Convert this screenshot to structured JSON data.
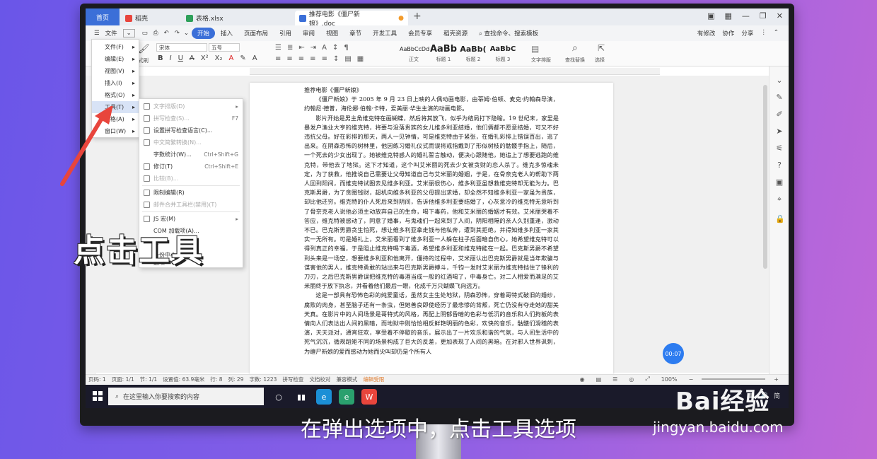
{
  "tabs": {
    "home": "首页",
    "t1": "稻壳",
    "t2": "表格.xlsx",
    "t3": "推荐电影《僵尸新娘》.doc"
  },
  "menubar": {
    "items": [
      "文件",
      "开始",
      "插入",
      "页面布局",
      "引用",
      "审阅",
      "视图",
      "章节",
      "开发工具",
      "会员专享",
      "稻壳资源"
    ],
    "active": "开始",
    "search": "查找命令、搜索模板",
    "right": [
      "有修改",
      "协作",
      "分享"
    ]
  },
  "ribbon": {
    "font_name": "宋体",
    "font_size": "五号",
    "styles": [
      {
        "preview": "AaBbCcDd",
        "label": "正文"
      },
      {
        "preview": "AaBb",
        "label": "标题 1"
      },
      {
        "preview": "AaBb(",
        "label": "标题 2"
      },
      {
        "preview": "AaBbC",
        "label": "标题 3"
      }
    ],
    "text_tool": "文字排版",
    "find_replace": "查找替换",
    "select": "选择",
    "fmt": "式刷"
  },
  "menu1": {
    "items": [
      {
        "label": "文件(F)",
        "arrow": "▸"
      },
      {
        "label": "编辑(E)",
        "arrow": "▸"
      },
      {
        "label": "视图(V)",
        "arrow": "▸"
      },
      {
        "label": "插入(I)",
        "arrow": "▸"
      },
      {
        "label": "格式(O)",
        "arrow": "▸"
      },
      {
        "label": "工具(T)",
        "arrow": "▸"
      },
      {
        "label": "表格(A)",
        "arrow": "▸"
      },
      {
        "label": "窗口(W)",
        "arrow": "▸"
      }
    ]
  },
  "menu2": {
    "items": [
      {
        "label": "文字排版(D)",
        "shortcut": "▸",
        "disabled": true
      },
      {
        "label": "拼写检查(S)...",
        "shortcut": "F7",
        "disabled": true
      },
      {
        "label": "设置拼写检查语言(C)...",
        "shortcut": "",
        "disabled": false
      },
      {
        "label": "中文简繁转换(N)...",
        "shortcut": "",
        "disabled": true
      },
      {
        "label": "字数统计(W)...",
        "shortcut": "Ctrl+Shift+G",
        "disabled": false
      },
      {
        "label": "修订(T)",
        "shortcut": "Ctrl+Shift+E",
        "disabled": false
      },
      {
        "label": "比较(B)...",
        "shortcut": "",
        "disabled": true
      },
      {
        "label": "限制编辑(R)",
        "shortcut": "",
        "disabled": false
      },
      {
        "label": "邮件合并工具栏(禁用)(T)",
        "shortcut": "",
        "disabled": true
      },
      {
        "label": "JS 宏(M)",
        "shortcut": "▸",
        "disabled": false
      },
      {
        "label": "COM 加载项(A)...",
        "shortcut": "",
        "disabled": false
      },
      {
        "label": "...",
        "shortcut": "",
        "disabled": false
      },
      {
        "label": "备份中心",
        "shortcut": "",
        "disabled": false
      },
      {
        "label": "选项",
        "shortcut": "",
        "disabled": false
      }
    ]
  },
  "document": {
    "title": "推荐电影《僵尸新娘》",
    "paragraphs": [
      "《僵尸新娘》于 2005 年 9 月 23 日上映的人偶动画电影，由蒂姆·伯顿、麦克·约翰森导演，约翰尼·德普，海伦娜·伯翰·卡特，爱美丽·华生主演的动画电影。",
      "影片开始是男主角维克特在画蝴蝶，然后将其放飞，似乎为结局打下隐喻。19 世纪末，家里是暴发户渔业大亨的维克特，将要与没落贵族的女儿维多利亚结婚，他们俩都不愿意结婚，可又不好违抗父母。好在彩排的那天，两人一见钟情，可是维克特由于紧张，在婚礼彩排上错误百出，逃了出来。在阴森恐怖的树林里，他因练习婚礼仪式而误将戒指戴到了形似树枝的骷髅手指上，随后，一个死去的少女出现了。她被维克特感人的婚礼誓言触动，便决心跟随他，她追上了想要逃跑的维克特，带他去了地狱。这下才知道，这个叫艾米丽的死去少女被贪财的恋人杀了。维克多惊魂未定，为了获救，他推说自己需要让父母知道自己与艾米丽的婚姻，于是，在骨奈克老人的帮助下两人回到阳间，而维克特试图去见维多利亚。艾米丽很伤心，维多利亚虽想救维克特却无能为力。巴克斯男爵，为了贪图钱财，超机向维多利亚的父母提出求婚，却全然不知维多利亚一家虽为贵族，却比他还穷。维克特的仆人死后来到阴间，告诉他维多利亚要结婚了，心灰意冷的维克特无意听到了骨奈克老人说他必须主动放弃自己的生命，喝下毒药，他和艾米丽的婚姻才有效。艾米丽哭着不答应，维克特被感动了，同意了婚事，与鬼魂们一起来到了人间，阴阳相隔的亲人久别重逢，激动不已。巴克斯男爵贪生怕死，想让维多利亚拿走钱与他私奔，遭到其拒绝，并得知维多利亚一家其实一无所有。可是婚礼上，艾米丽看到了维多利亚一人躲在柱子后面暗自伤心，她希望维克特可以得到真正的幸福，于是阻止维克特喝下毒酒，希望维多利亚和维克特能在一起。巴克斯男爵不希望到头来是一场空，想要维多利亚和他离开，僵持的过程中，艾米丽认出巴克斯男爵就是当年欺骗与谋害他的男人，维克特勇敢的站出来与巴克斯男爵搏斗，千钧一发时艾米丽为维克特挡住了锋利的刀刃，之后巴克斯男爵误把维克特的毒酒当成一般的红酒喝了，中毒身亡。对二人相爱而满足的艾米丽终于放下执念，并看着他们最后一眼，化成千万只蝴蝶飞向远方。",
      "这是一部具有恐怖色彩的纯爱童话，虽然女主生处地狱，阴森恐怖，穿着哥特式破旧的婚纱，腐败的肉身，甚至脑子还有一条虫，但她善良即使经历了最悲惨的背叛，死亡仍没有夺走她的甜美天真。在影片中的人间场景是哥特式的风格，再配上阴郁昏暗的色彩与低沉的音乐和人们拘板的表情向人们表达出人间的黑暗，而地狱中则恰恰相反鲜艳明丽的色彩，欢快的音乐，骷髅们滑稽的表演，天天派对，通宵狂欢，享受着不停歇的音乐，展示出了一片欢乐和谐的气氛，与人间生活中的死气沉沉，循规蹈矩不同的场景构成了巨大的反差，更加表现了人间的黑暗。在对邪人世界讽刺，为缠尸新娘的爱而感动为她而尖叫却仍是个所有人"
    ]
  },
  "status": {
    "items": [
      "页码: 1",
      "页面: 1/1",
      "节: 1/1",
      "设置值: 63.9毫米",
      "行: 8",
      "列: 29",
      "字数: 1223",
      "拼写检查",
      "文档校对",
      "兼容模式",
      "编辑受限"
    ],
    "zoom": "100%"
  },
  "timer": "00:07",
  "taskbar": {
    "search_placeholder": "在这里输入你要搜索的内容",
    "tray": "简"
  },
  "overlay": {
    "big_label": "点击工具",
    "subtitle": "在弹出选项中，点击工具选项",
    "watermark": "Bai经验",
    "watermark_url": "jingyan.baidu.com"
  },
  "colors": {
    "accent": "#3b6fd8",
    "arrow": "#e8453c"
  }
}
